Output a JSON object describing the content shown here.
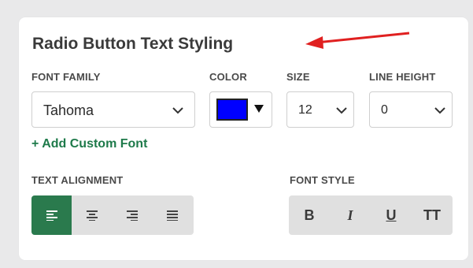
{
  "panel": {
    "title": "Radio Button Text Styling"
  },
  "font_family": {
    "label": "FONT FAMILY",
    "value": "Tahoma",
    "add_custom_font": "+ Add Custom Font"
  },
  "color": {
    "label": "COLOR",
    "value": "#0000ff"
  },
  "size": {
    "label": "SIZE",
    "value": "12"
  },
  "line_height": {
    "label": "LINE HEIGHT",
    "value": "0"
  },
  "text_alignment": {
    "label": "TEXT ALIGNMENT",
    "options": [
      "align-left-icon",
      "align-center-icon",
      "align-right-icon",
      "align-justify-icon"
    ],
    "selected": "align-left-icon"
  },
  "font_style": {
    "label": "FONT STYLE",
    "buttons": [
      "B",
      "I",
      "U",
      "TT"
    ]
  },
  "colors": {
    "accent_green": "#2a7a4d",
    "link_green": "#1e7a4a",
    "annotation_arrow": "#e02020"
  }
}
